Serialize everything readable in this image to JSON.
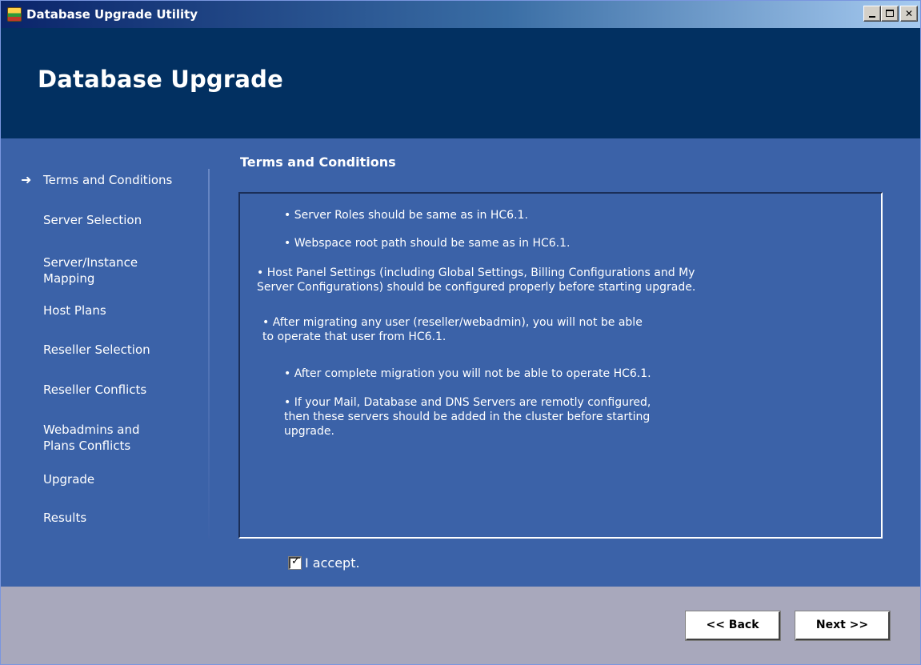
{
  "window": {
    "title": "Database Upgrade Utility",
    "controls": {
      "minimize": "minimize",
      "maximize": "maximize",
      "close": "✕"
    }
  },
  "header": {
    "title": "Database Upgrade"
  },
  "sidebar": {
    "active_index": 0,
    "items": [
      {
        "label": "Terms and Conditions"
      },
      {
        "label": "Server Selection"
      },
      {
        "label": "Server/Instance\nMapping"
      },
      {
        "label": "Host Plans"
      },
      {
        "label": "Reseller Selection"
      },
      {
        "label": "Reseller Conflicts"
      },
      {
        "label": "Webadmins and\nPlans Conflicts"
      },
      {
        "label": "Upgrade"
      },
      {
        "label": "Results"
      }
    ]
  },
  "main": {
    "section_title": "Terms and Conditions",
    "terms": [
      "• Server Roles should be same as in HC6.1.",
      "• Webspace root path should be same as in HC6.1.",
      "• Host Panel Settings (including Global Settings, Billing Configurations and My\nServer Configurations) should be configured properly before starting upgrade.",
      "• After migrating any user (reseller/webadmin), you will not be able\nto operate that user from HC6.1.",
      "• After complete migration you will not be able to operate HC6.1.",
      "• If your Mail, Database and DNS Servers are remotly configured,\nthen these servers should be added in the cluster before starting\nupgrade."
    ],
    "accept": {
      "label": "I accept.",
      "checked": true
    }
  },
  "footer": {
    "back_label": "<< Back",
    "next_label": "Next >>"
  },
  "colors": {
    "header_bg": "#023061",
    "body_bg": "#3b62a8",
    "footer_bg": "#a8a8bc",
    "text": "#ffffff"
  }
}
